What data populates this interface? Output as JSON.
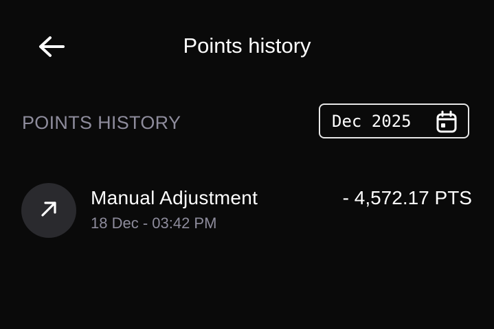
{
  "header": {
    "title": "Points history",
    "back_icon": "arrow-left-icon"
  },
  "section": {
    "label": "POINTS HISTORY",
    "month_picker": {
      "value": "Dec 2025",
      "icon": "calendar-icon"
    }
  },
  "transactions": [
    {
      "icon": "arrow-up-right-icon",
      "title": "Manual Adjustment",
      "time": "18 Dec - 03:42 PM",
      "amount": "- 4,572.17 PTS"
    }
  ],
  "colors": {
    "background": "#0a0a0a",
    "text_primary": "#ffffff",
    "text_secondary": "#8e8c9c",
    "avatar_bg": "#2a2a2e"
  }
}
